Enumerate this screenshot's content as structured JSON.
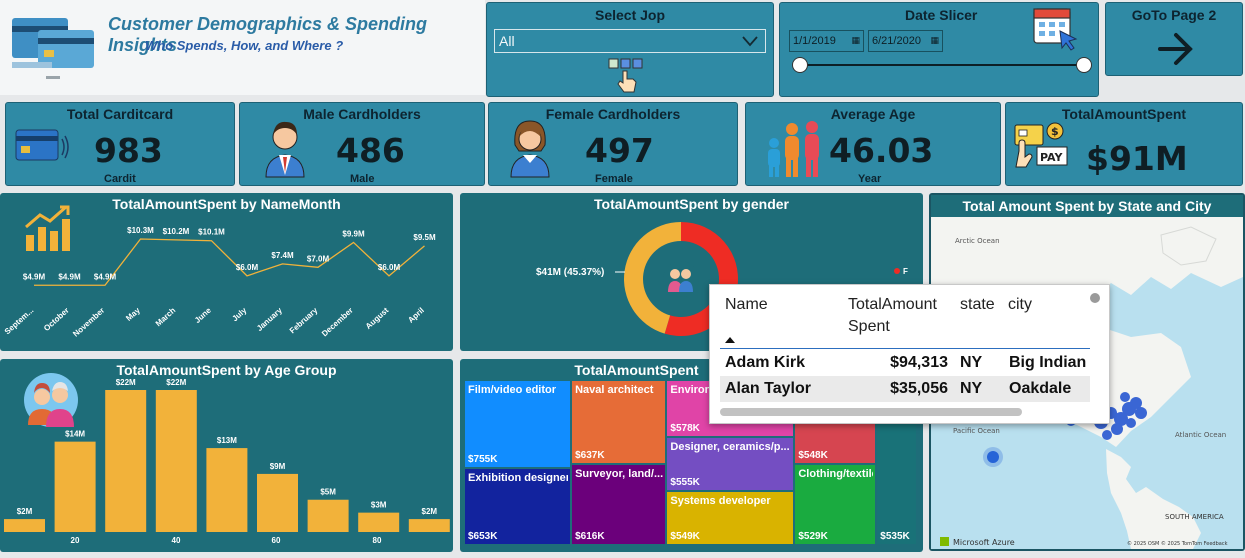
{
  "header": {
    "title": "Customer Demographics & Spending Insights",
    "subtitle": "Who Spends, How, and Where ?"
  },
  "job_slicer": {
    "title": "Select Jop",
    "value": "All"
  },
  "date_slicer": {
    "title": "Date Slicer",
    "start": "1/1/2019",
    "end": "6/21/2020"
  },
  "goto": {
    "label": "GoTo Page 2"
  },
  "kpis": [
    {
      "title": "Total Carditcard",
      "value": "983",
      "sub": "Cardit"
    },
    {
      "title": "Male Cardholders",
      "value": "486",
      "sub": "Male"
    },
    {
      "title": "Female Cardholders",
      "value": "497",
      "sub": "Female"
    },
    {
      "title": "Average Age",
      "value": "46.03",
      "sub": "Year"
    },
    {
      "title": "TotalAmountSpent",
      "value": "$91M",
      "sub": ""
    }
  ],
  "map": {
    "title": "Total Amount Spent by State and City",
    "labels": {
      "arctic": "Arctic Ocean",
      "pacific": "Pacific Ocean",
      "atlantic": "Atlantic Ocean",
      "sa": "SOUTH AMERICA",
      "azure": "Microsoft Azure",
      "copy": "© 2025 OSM  © 2025 TomTom  Feedback"
    }
  },
  "tooltip": {
    "headers": [
      "Name",
      "TotalAmount Spent",
      "state",
      "city"
    ],
    "rows": [
      {
        "name": "Adam Kirk",
        "amount": "$94,313",
        "state": "NY",
        "city": "Big Indian"
      },
      {
        "name": "Alan Taylor",
        "amount": "$35,056",
        "state": "NY",
        "city": "Oakdale"
      }
    ]
  },
  "chart_data": [
    {
      "type": "line",
      "title": "TotalAmountSpent by NameMonth",
      "categories": [
        "Septem...",
        "October",
        "November",
        "May",
        "March",
        "June",
        "July",
        "January",
        "February",
        "December",
        "August",
        "April"
      ],
      "values": [
        4.9,
        4.9,
        4.9,
        10.3,
        10.2,
        10.1,
        6.0,
        7.4,
        7.0,
        9.9,
        6.0,
        9.5
      ],
      "labels": [
        "$4.9M",
        "$4.9M",
        "$4.9M",
        "$10.3M",
        "$10.2M",
        "$10.1M",
        "$6.0M",
        "$7.4M",
        "$7.0M",
        "$9.9M",
        "$6.0M",
        "$9.5M"
      ],
      "color": "#f1b23a"
    },
    {
      "type": "pie",
      "title": "TotalAmountSpent by gender",
      "slices": [
        {
          "name": "F",
          "value": 54.63,
          "color": "#ee2c24"
        },
        {
          "name": "M",
          "value": 45.37,
          "color": "#f2b23a"
        }
      ],
      "data_labels": [
        "$41M (45.37%)"
      ],
      "legend": [
        "F"
      ]
    },
    {
      "type": "bar",
      "title": "TotalAmountSpent by Age Group",
      "values": [
        2,
        14,
        22,
        22,
        13,
        9,
        5,
        3,
        2
      ],
      "labels": [
        "$2M",
        "$14M",
        "$22M",
        "$22M",
        "$13M",
        "$9M",
        "$5M",
        "$3M",
        "$2M"
      ],
      "ticks": [
        "20",
        "40",
        "60",
        "80"
      ],
      "color": "#f2b23a"
    },
    {
      "type": "treemap",
      "title": "TotalAmountSpent",
      "tiles": [
        {
          "name": "Film/video editor",
          "value": 755,
          "label": "$755K",
          "color": "#118dff"
        },
        {
          "name": "Exhibition designer",
          "value": 653,
          "label": "$653K",
          "color": "#12239e"
        },
        {
          "name": "Naval architect",
          "value": 637,
          "label": "$637K",
          "color": "#e66c37"
        },
        {
          "name": "Surveyor, land/...",
          "value": 616,
          "label": "$616K",
          "color": "#6b007b"
        },
        {
          "name": "Environ...",
          "value": 578,
          "label": "$578K",
          "color": "#e044a7"
        },
        {
          "name": "Designer, ceramics/p...",
          "value": 555,
          "label": "$555K",
          "color": "#744ec2"
        },
        {
          "name": "Systems developer",
          "value": 549,
          "label": "$549K",
          "color": "#d9b300"
        },
        {
          "name": "",
          "value": 548,
          "label": "$548K",
          "color": "#d64550"
        },
        {
          "name": "",
          "value": 535,
          "label": "$535K",
          "color": "#197278"
        },
        {
          "name": "Clothing/textile tech...",
          "value": 529,
          "label": "$529K",
          "color": "#1aab40"
        }
      ]
    }
  ]
}
